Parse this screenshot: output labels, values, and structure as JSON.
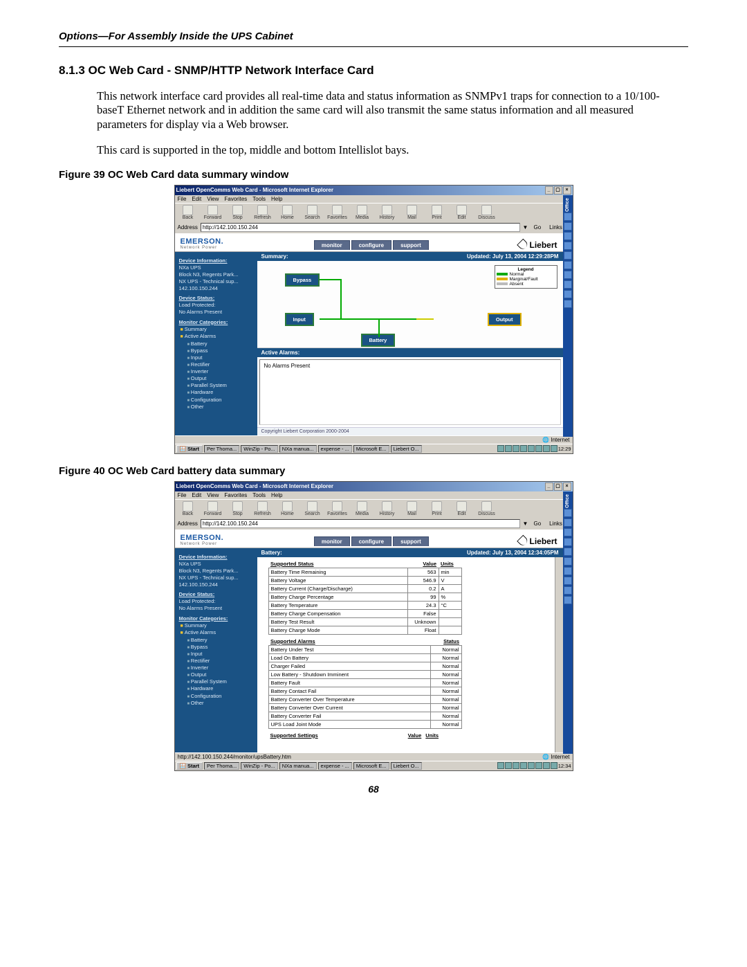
{
  "running_header": "Options—For Assembly Inside the UPS Cabinet",
  "section_number_title": "8.1.3   OC Web Card - SNMP/HTTP Network Interface Card",
  "para1": "This network interface card provides all real-time data and status information as SNMPv1 traps for connection to a 10/100-baseT Ethernet network and in addition the same card will also transmit the same status information and all measured parameters for display via a Web browser.",
  "para2": "This card is supported in the top, middle and bottom Intellislot bays.",
  "figure39_caption": "Figure 39  OC Web Card data summary window",
  "figure40_caption": "Figure 40  OC Web Card battery data summary",
  "page_number": "68",
  "ie": {
    "title": "Liebert OpenComms Web Card - Microsoft Internet Explorer",
    "menu": [
      "File",
      "Edit",
      "View",
      "Favorites",
      "Tools",
      "Help"
    ],
    "toolbar": [
      "Back",
      "Forward",
      "Stop",
      "Refresh",
      "Home",
      "Search",
      "Favorites",
      "Media",
      "History",
      "Mail",
      "Print",
      "Edit",
      "Discuss"
    ],
    "address_label": "Address",
    "go_label": "Go",
    "links_label": "Links »"
  },
  "office_label": "Office",
  "brand_emerson": "EMERSON.",
  "brand_emerson_sub": "Network Power",
  "brand_liebert": "Liebert",
  "tabs": [
    "monitor",
    "configure",
    "support"
  ],
  "sidebar_common": {
    "device_info_hdr": "Device Information:",
    "device_info_lines": [
      "NXa UPS",
      "Block N3, Regents Park...",
      "NX UPS - Technical sup...",
      "142.100.150.244"
    ],
    "device_status_hdr": "Device Status:",
    "device_status_lines": [
      "Load Protected:",
      "No Alarms Present"
    ],
    "monitor_cat_hdr": "Monitor Categories:",
    "categories": [
      "Summary",
      "Active Alarms",
      "Battery",
      "Bypass",
      "Input",
      "Rectifier",
      "Inverter",
      "Output",
      "Parallel System",
      "Hardware",
      "Configuration",
      "Other"
    ]
  },
  "fig39": {
    "address_value": "http://142.100.150.244",
    "panel_title_left": "Summary:",
    "panel_title_right": "Updated: July 13, 2004 12:29:28PM",
    "node_bypass": "Bypass",
    "node_input": "Input",
    "node_output": "Output",
    "node_battery": "Battery",
    "legend_title": "Legend",
    "legend_items": [
      {
        "color": "#11aa11",
        "label": "Normal"
      },
      {
        "color": "#e0b000",
        "label": "Marginal/Fault"
      },
      {
        "color": "#bbbbbb",
        "label": "Absent"
      }
    ],
    "active_alarms_hdr": "Active Alarms:",
    "alarms_body": "No Alarms Present",
    "copyright": "Copyright Liebert Corporation 2000-2004",
    "statusbar_right": "Internet",
    "taskbar_tasks": [
      "Per Thoma...",
      "WinZip - Po...",
      "NXa manua...",
      "expense - ...",
      "Microsoft E...",
      "Liebert O..."
    ],
    "taskbar_time": "12:29"
  },
  "fig40": {
    "address_value": "http://142.100.150.244",
    "panel_title_left": "Battery:",
    "panel_title_right": "Updated: July 13, 2004 12:34:05PM",
    "status_hdr": "Supported Status",
    "value_hdr": "Value",
    "units_hdr": "Units",
    "status_rows": [
      {
        "label": "Battery Time Remaining",
        "value": "563",
        "unit": "min"
      },
      {
        "label": "Battery Voltage",
        "value": "546.9",
        "unit": "V"
      },
      {
        "label": "Battery Current (Charge/Discharge)",
        "value": "0.2",
        "unit": "A"
      },
      {
        "label": "Battery Charge Percentage",
        "value": "99",
        "unit": "%"
      },
      {
        "label": "Battery Temperature",
        "value": "24.3",
        "unit": "°C"
      },
      {
        "label": "Battery Charge Compensation",
        "value": "False",
        "unit": ""
      },
      {
        "label": "Battery Test Result",
        "value": "Unknown",
        "unit": ""
      },
      {
        "label": "Battery Charge Mode",
        "value": "Float",
        "unit": ""
      }
    ],
    "alarms_hdr": "Supported Alarms",
    "alarms_status_hdr": "Status",
    "alarms_rows": [
      {
        "label": "Battery Under Test",
        "status": "Normal"
      },
      {
        "label": "Load On Battery",
        "status": "Normal"
      },
      {
        "label": "Charger Failed",
        "status": "Normal"
      },
      {
        "label": "Low Battery - Shutdown Imminent",
        "status": "Normal"
      },
      {
        "label": "Battery Fault",
        "status": "Normal"
      },
      {
        "label": "Battery Contact Fail",
        "status": "Normal"
      },
      {
        "label": "Battery Converter Over Temperature",
        "status": "Normal"
      },
      {
        "label": "Battery Converter Over Current",
        "status": "Normal"
      },
      {
        "label": "Battery Converter Fail",
        "status": "Normal"
      },
      {
        "label": "UPS Load Joint Mode",
        "status": "Normal"
      }
    ],
    "settings_hdr": "Supported Settings",
    "statusbar_left": "http://142.100.150.244/monitor/upsBattery.htm",
    "statusbar_right": "Internet",
    "taskbar_tasks": [
      "Per Thoma...",
      "WinZip - Po...",
      "NXa manua...",
      "expense - ...",
      "Microsoft E...",
      "Liebert O..."
    ],
    "taskbar_time": "12:34"
  },
  "start_label": "Start"
}
